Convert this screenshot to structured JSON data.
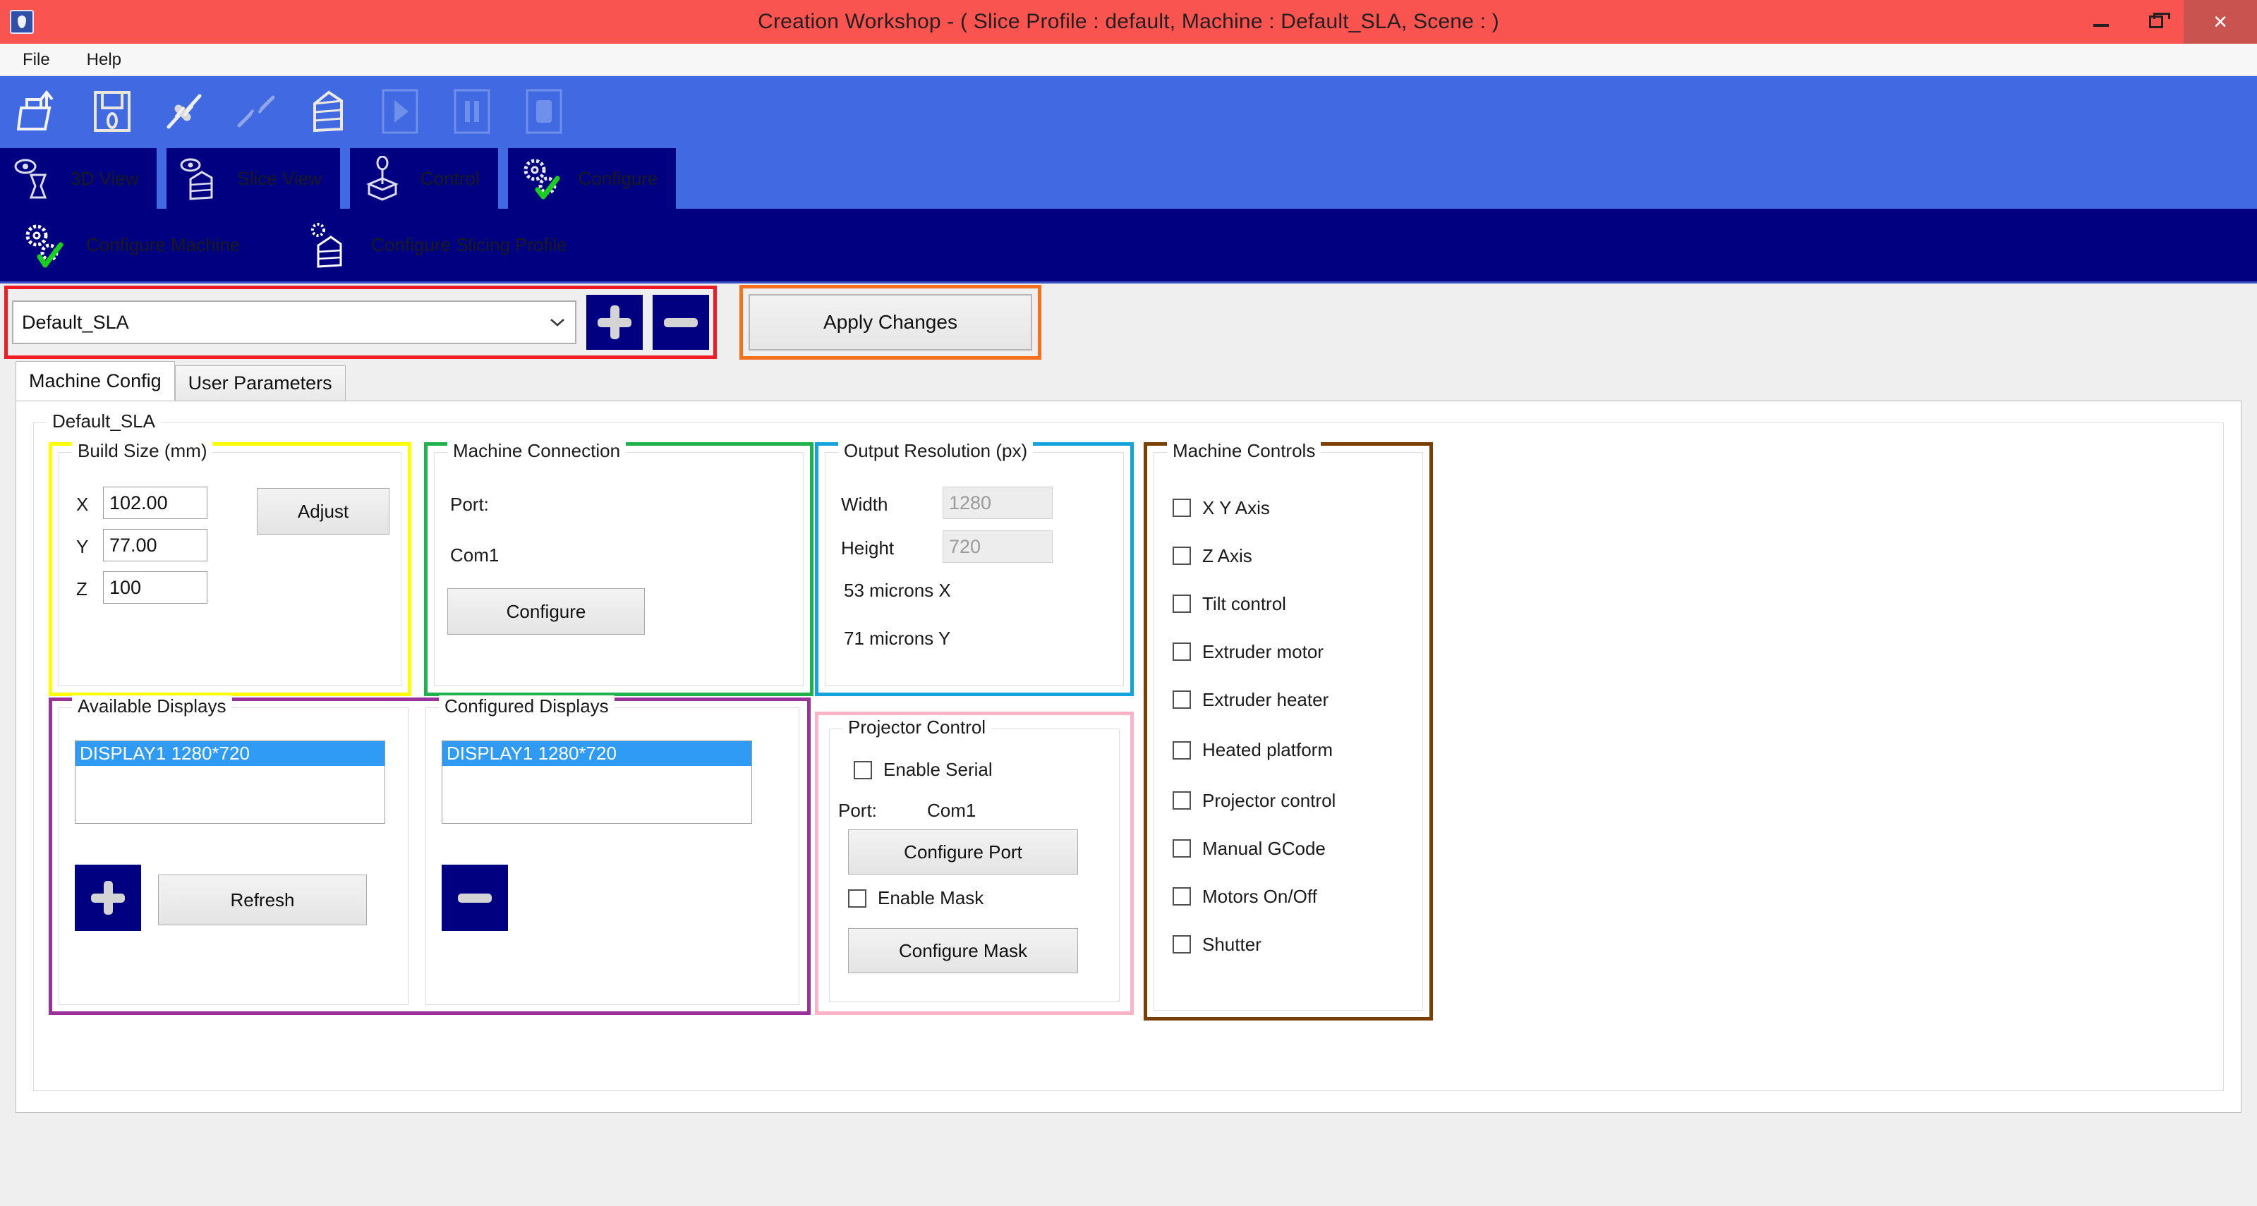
{
  "window": {
    "title": "Creation Workshop -  ( Slice Profile : default, Machine : Default_SLA, Scene : )",
    "minimize_label": "minimize-window",
    "maximize_label": "restore-window",
    "close_label": "×"
  },
  "menubar": {
    "items": [
      {
        "label": "File"
      },
      {
        "label": "Help"
      }
    ]
  },
  "toolbar": {
    "buttons": [
      {
        "icon": "open-file-icon",
        "label": "Open"
      },
      {
        "icon": "save-file-icon",
        "label": "Save"
      },
      {
        "icon": "connect-icon",
        "label": "Connect"
      },
      {
        "icon": "disconnect-icon",
        "label": "Disconnect"
      },
      {
        "icon": "slice-icon",
        "label": "Slice"
      },
      {
        "icon": "play-icon",
        "label": "Play"
      },
      {
        "icon": "pause-icon",
        "label": "Pause"
      },
      {
        "icon": "stop-icon",
        "label": "Stop"
      }
    ]
  },
  "main_tabs": [
    {
      "label": "3D View",
      "icon": "eye-model-icon"
    },
    {
      "label": "Slice View",
      "icon": "eye-slice-icon"
    },
    {
      "label": "Control",
      "icon": "joystick-icon"
    },
    {
      "label": "Configure",
      "icon": "gears-check-icon"
    }
  ],
  "sub_tabs": [
    {
      "label": "Configure Machine",
      "icon": "gears-check-icon"
    },
    {
      "label": "Configure Slicing Profile",
      "icon": "slice-gear-icon"
    }
  ],
  "profile_row": {
    "selected_profile": "Default_SLA",
    "caret": "⌄",
    "add_label": "add-profile",
    "remove_label": "remove-profile",
    "apply_label": "Apply Changes"
  },
  "config_tabs": [
    {
      "label": "Machine Config",
      "active": true
    },
    {
      "label": "User Parameters",
      "active": false
    }
  ],
  "panel": {
    "group_title": "Default_SLA"
  },
  "build_size": {
    "title": "Build Size (mm)",
    "x_label": "X",
    "x_value": "102.00",
    "y_label": "Y",
    "y_value": "77.00",
    "z_label": "Z",
    "z_value": "100",
    "adjust_label": "Adjust"
  },
  "machine_connection": {
    "title": "Machine Connection",
    "port_label": "Port:",
    "port_value": "Com1",
    "configure_label": "Configure"
  },
  "output_resolution": {
    "title": "Output Resolution (px)",
    "width_label": "Width",
    "width_value": "1280",
    "height_label": "Height",
    "height_value": "720",
    "microns_x": "53 microns X",
    "microns_y": "71 microns Y"
  },
  "machine_controls": {
    "title": "Machine Controls",
    "items": [
      {
        "label": "X Y Axis",
        "checked": false
      },
      {
        "label": "Z Axis",
        "checked": false
      },
      {
        "label": "Tilt control",
        "checked": false
      },
      {
        "label": "Extruder motor",
        "checked": false
      },
      {
        "label": "Extruder heater",
        "checked": false
      },
      {
        "label": "Heated platform",
        "checked": false
      },
      {
        "label": "Projector control",
        "checked": false
      },
      {
        "label": "Manual GCode",
        "checked": false
      },
      {
        "label": "Motors On/Off",
        "checked": false
      },
      {
        "label": "Shutter",
        "checked": false
      }
    ]
  },
  "available_displays": {
    "title": "Available Displays",
    "items": [
      "DISPLAY1 1280*720"
    ],
    "add_label": "add-display",
    "refresh_label": "Refresh"
  },
  "configured_displays": {
    "title": "Configured Displays",
    "items": [
      "DISPLAY1 1280*720"
    ],
    "remove_label": "remove-display"
  },
  "projector_control": {
    "title": "Projector Control",
    "enable_serial_label": "Enable Serial",
    "enable_serial_checked": false,
    "port_label": "Port:",
    "port_value": "Com1",
    "configure_port_label": "Configure Port",
    "enable_mask_label": "Enable Mask",
    "enable_mask_checked": false,
    "configure_mask_label": "Configure Mask"
  },
  "highlight_colors": {
    "profile_selector": "#ee1c25",
    "apply_changes": "#f4711f",
    "build_size": "#ffff00",
    "machine_connection": "#1fb14b",
    "output_resolution": "#14a3dc",
    "machine_controls": "#7a3f00",
    "displays": "#993399",
    "projector_control": "#ffb3c6"
  },
  "theme": {
    "titlebar": "#f95450",
    "toolbar": "#4169e1",
    "tab_navy": "#000080"
  }
}
